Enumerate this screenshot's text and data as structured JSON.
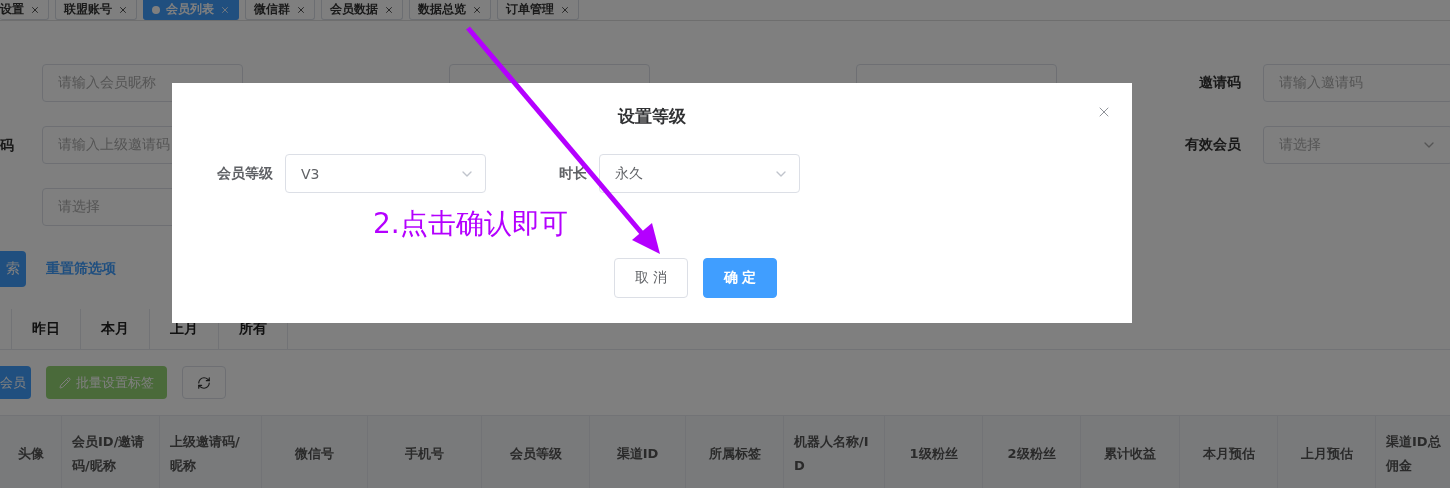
{
  "tabs": [
    {
      "label": "设置",
      "selected": false
    },
    {
      "label": "联盟账号",
      "selected": false
    },
    {
      "label": "会员列表",
      "selected": true
    },
    {
      "label": "微信群",
      "selected": false
    },
    {
      "label": "会员数据",
      "selected": false
    },
    {
      "label": "数据总览",
      "selected": false
    },
    {
      "label": "订单管理",
      "selected": false
    }
  ],
  "filters": [
    [
      {
        "kind": "input",
        "placeholder": "请输入会员昵称"
      },
      {
        "kind": "input"
      },
      {
        "kind": "input"
      },
      {
        "kind": "input",
        "label": "邀请码",
        "placeholder": "请输入邀请码"
      }
    ],
    [
      {
        "kind": "input",
        "label": "码",
        "placeholder": "请输入上级邀请码"
      },
      {
        "kind": "select",
        "label": "有效会员",
        "placeholder": "请选择"
      }
    ],
    [
      {
        "kind": "input",
        "placeholder": "请选择"
      }
    ]
  ],
  "search_button": "索",
  "reset_link": "重置筛选项",
  "date_tabs": [
    "昨日",
    "本月",
    "上月",
    "所有"
  ],
  "actions": {
    "add_button": "会员",
    "tag_button": "批量设置标签"
  },
  "table": {
    "columns": [
      "头像",
      "会员ID/邀请码/昵称",
      "上级邀请码/昵称",
      "微信号",
      "手机号",
      "会员等级",
      "渠道ID",
      "所属标签",
      "机器人名称/ID",
      "1级粉丝",
      "2级粉丝",
      "累计收益",
      "本月预估",
      "上月预估",
      "渠道ID总佣金"
    ]
  },
  "dialog": {
    "title": "设置等级",
    "fields": [
      {
        "label": "会员等级",
        "value": "V3"
      },
      {
        "label": "时长",
        "value": "永久"
      }
    ],
    "annotation": "2.点击确认即可",
    "buttons": [
      {
        "kind": "secondary",
        "label": "取 消"
      },
      {
        "kind": "primary",
        "label": "确 定"
      }
    ]
  }
}
